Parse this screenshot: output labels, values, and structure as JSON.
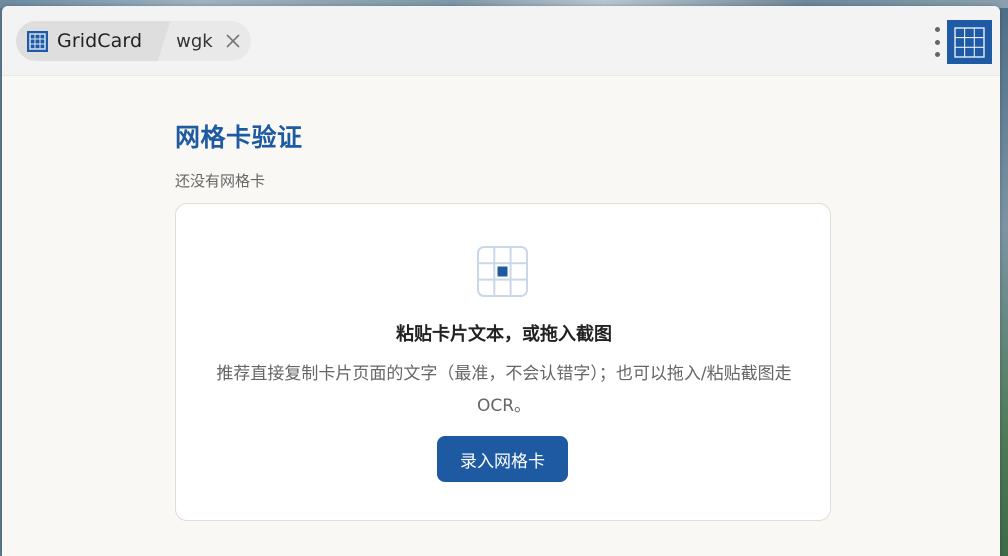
{
  "toolbar": {
    "app_tab_label": "GridCard",
    "item_tab_label": "wgk"
  },
  "main": {
    "title": "网格卡验证",
    "subtitle": "还没有网格卡"
  },
  "card": {
    "title": "粘贴卡片文本，或拖入截图",
    "description": "推荐直接复制卡片页面的文字（最准，不会认错字）；也可以拖入/粘贴截图走OCR。",
    "button_label": "录入网格卡"
  },
  "colors": {
    "accent": "#1f5aa5",
    "title": "#1e5aa0",
    "background": "#f9f8f5"
  }
}
